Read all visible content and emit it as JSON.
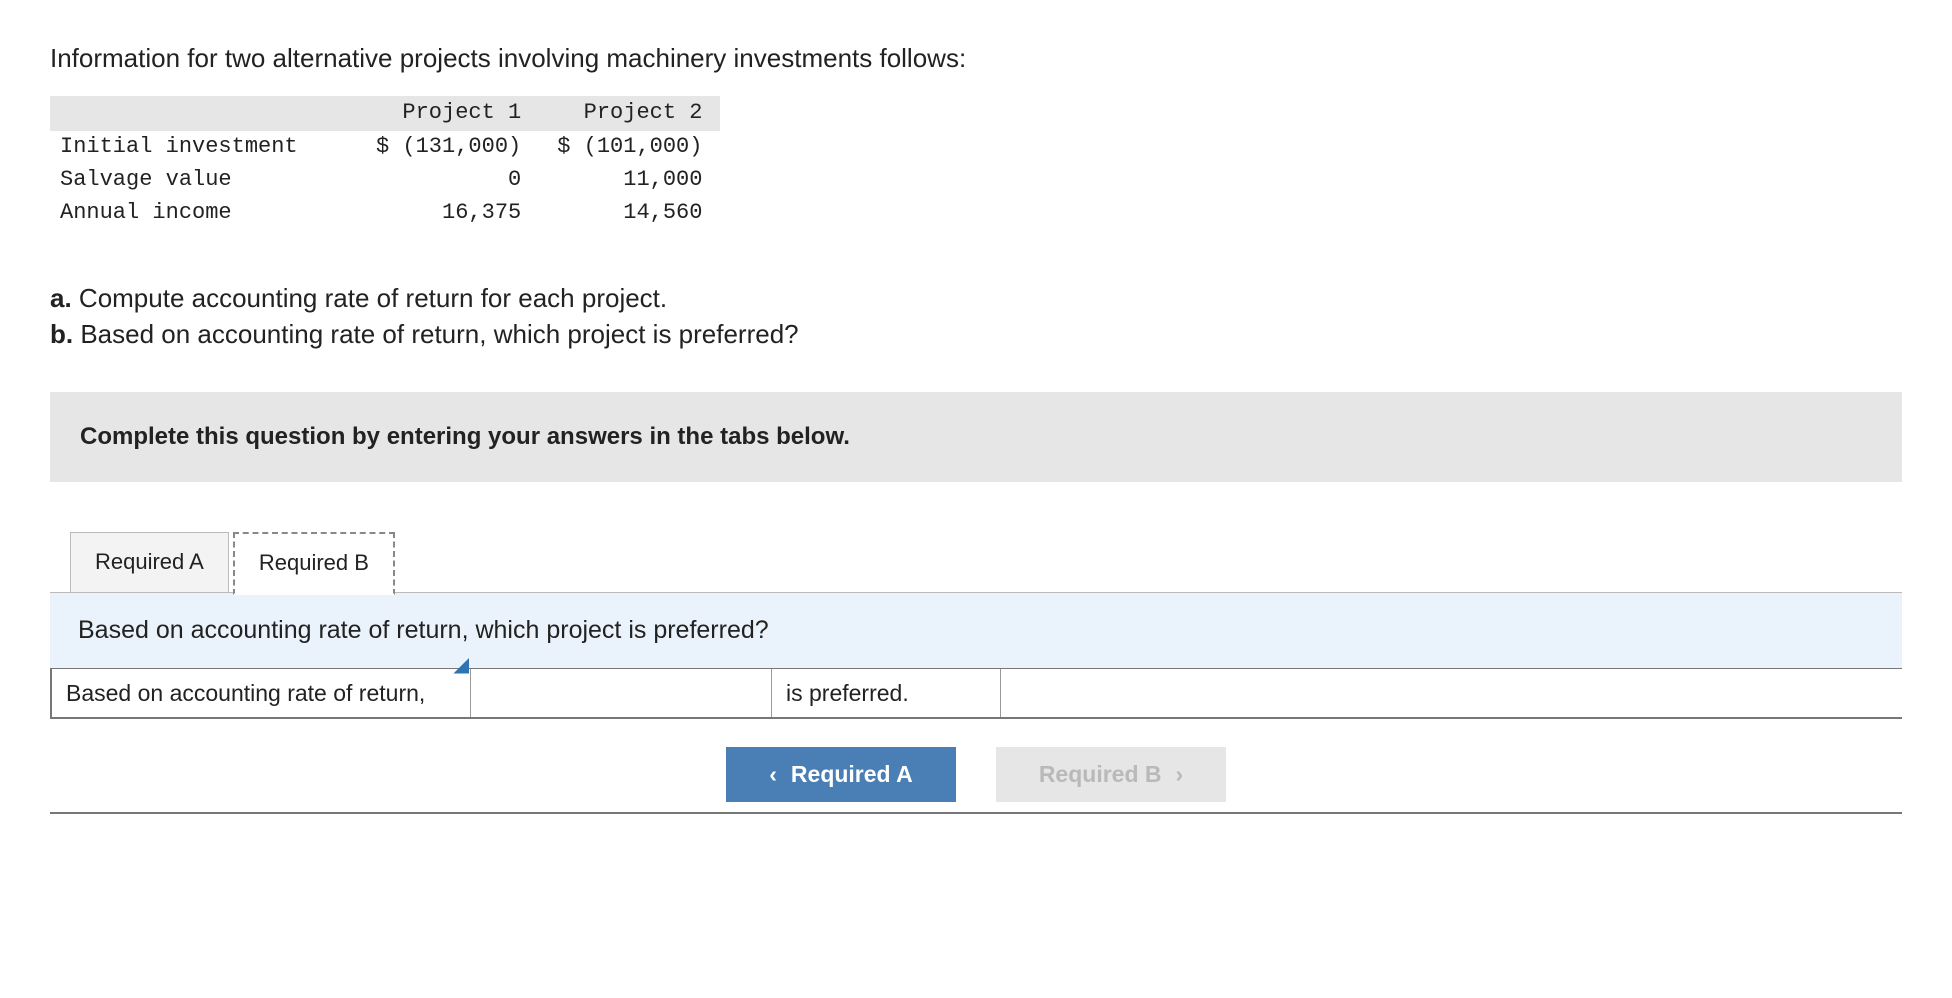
{
  "intro": "Information for two alternative projects involving machinery investments follows:",
  "table": {
    "headers": [
      "",
      "Project 1",
      "Project 2"
    ],
    "rows": [
      {
        "label": "Initial investment",
        "p1": "$ (131,000)",
        "p2": "$ (101,000)"
      },
      {
        "label": "Salvage value",
        "p1": "0",
        "p2": "11,000"
      },
      {
        "label": "Annual income",
        "p1": "16,375",
        "p2": "14,560"
      }
    ]
  },
  "questions": {
    "a_label": "a.",
    "a_text": " Compute accounting rate of return for each project.",
    "b_label": "b.",
    "b_text": " Based on accounting rate of return, which project is preferred?"
  },
  "instruction": "Complete this question by entering your answers in the tabs below.",
  "tabs": {
    "a": "Required A",
    "b": "Required B"
  },
  "prompt": "Based on accounting rate of return, which project is preferred?",
  "answer": {
    "prefix": "Based on accounting rate of return,",
    "value": "",
    "suffix": "is preferred."
  },
  "nav": {
    "prev": "Required A",
    "next": "Required B"
  }
}
